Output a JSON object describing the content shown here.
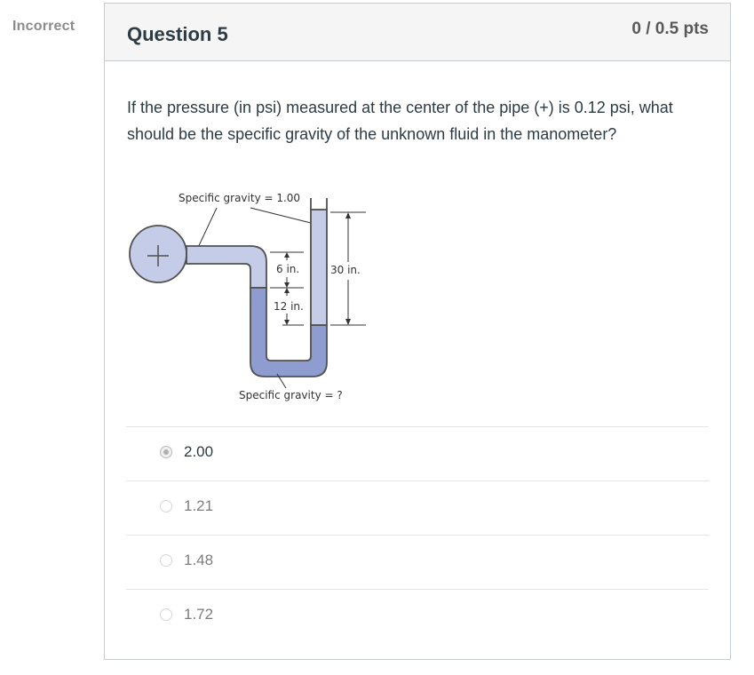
{
  "status": "Incorrect",
  "question": {
    "title": "Question 5",
    "points": "0 / 0.5 pts",
    "text": "If the pressure (in psi) measured at the center of the pipe (+) is 0.12 psi, what should be the specific gravity of the unknown fluid in the manometer?"
  },
  "diagram": {
    "label_top": "Specific gravity = 1.00",
    "label_bottom": "Specific gravity = ?",
    "dim_6": "6 in.",
    "dim_12": "12 in.",
    "dim_30": "30 in."
  },
  "answers": [
    {
      "label": "2.00",
      "selected": true
    },
    {
      "label": "1.21",
      "selected": false
    },
    {
      "label": "1.48",
      "selected": false
    },
    {
      "label": "1.72",
      "selected": false
    }
  ],
  "colors": {
    "light_fluid": "#c5cce8",
    "dark_fluid": "#8e9ccf",
    "outline": "#505050"
  }
}
